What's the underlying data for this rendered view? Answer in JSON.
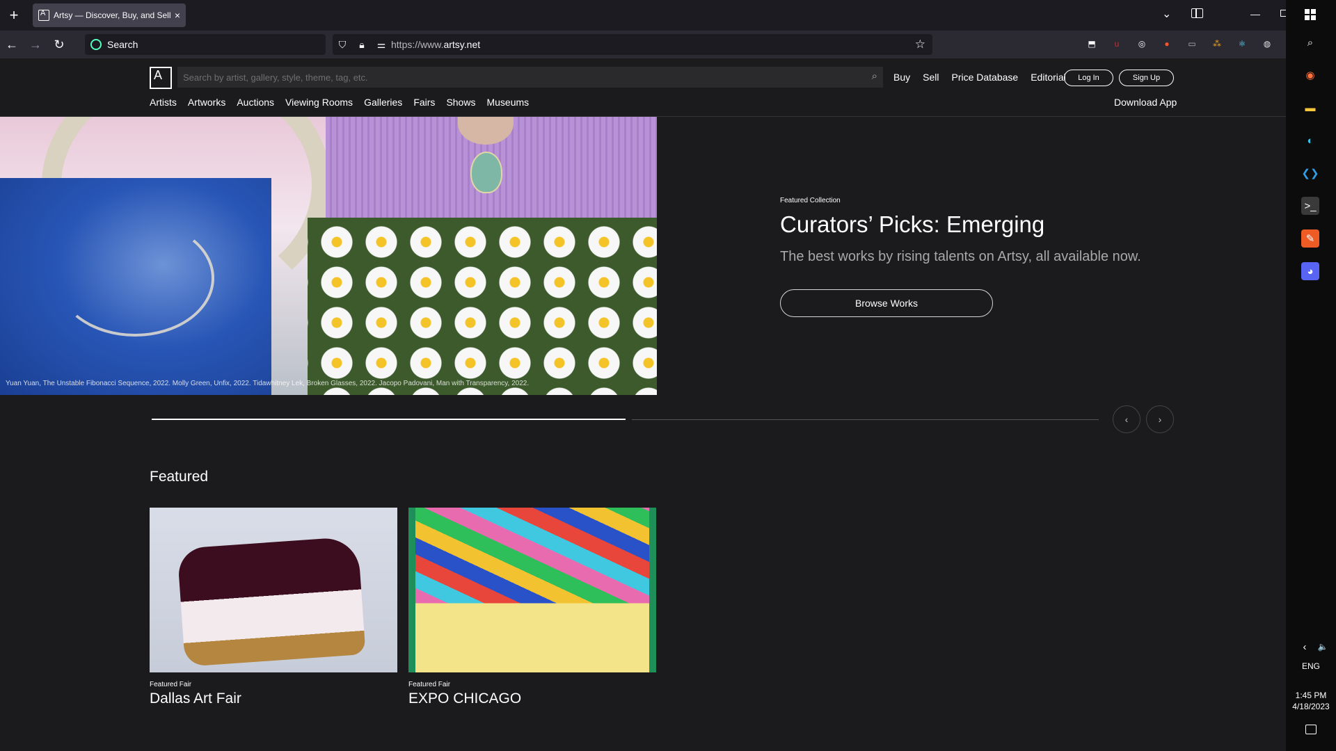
{
  "browser": {
    "tab_title": "Artsy — Discover, Buy, and Sell Fine Art",
    "search_placeholder": "Search",
    "url_scheme": "https://www.",
    "url_domain": "artsy.net",
    "new_tab_icon": "+",
    "tab_close_icon": "×",
    "back_icon": "←",
    "forward_icon": "→",
    "reload_icon": "↻",
    "bookmark_icon": "☆",
    "tab_list_icon": "⌄",
    "minimize_icon": "—",
    "extensions": [
      {
        "name": "downloads-icon",
        "glyph": "⬒",
        "color": "#fbfbfe"
      },
      {
        "name": "ublock-icon",
        "glyph": "u",
        "color": "#c4302b"
      },
      {
        "name": "privacy-icon",
        "glyph": "◎",
        "color": "#fbfbfe"
      },
      {
        "name": "brave-icon",
        "glyph": "●",
        "color": "#fb542b"
      },
      {
        "name": "extension-icon",
        "glyph": "▭",
        "color": "#b0b0b0"
      },
      {
        "name": "dots-icon",
        "glyph": "⁂",
        "color": "#f4a51c"
      },
      {
        "name": "react-icon",
        "glyph": "⚛",
        "color": "#61dafb"
      },
      {
        "name": "globe-icon",
        "glyph": "◍",
        "color": "#e0e0e0"
      }
    ]
  },
  "site": {
    "logo": "A",
    "search_placeholder": "Search by artist, gallery, style, theme, tag, etc.",
    "top_links": [
      "Buy",
      "Sell",
      "Price Database",
      "Editorial"
    ],
    "login_label": "Log In",
    "signup_label": "Sign Up",
    "categories": [
      "Artists",
      "Artworks",
      "Auctions",
      "Viewing Rooms",
      "Galleries",
      "Fairs",
      "Shows",
      "Museums"
    ],
    "download_app": "Download App"
  },
  "hero": {
    "caption": "Yuan Yuan, The Unstable Fibonacci Sequence, 2022. Molly Green, Unfix, 2022. Tidawhitney Lek, Broken Glasses, 2022. Jacopo Padovani, Man with Transparency, 2022.",
    "kicker": "Featured Collection",
    "title": "Curators’ Picks: Emerging",
    "subtitle": "The best works by rising talents on Artsy, all available now.",
    "button": "Browse Works",
    "carousel_progress": 0.5
  },
  "featured": {
    "heading": "Featured",
    "cards": [
      {
        "kicker": "Featured Fair",
        "title": "Dallas Art Fair"
      },
      {
        "kicker": "Featured Fair",
        "title": "EXPO CHICAGO"
      }
    ]
  },
  "taskbar": {
    "apps": [
      {
        "name": "search-icon",
        "glyph": "⌕",
        "color": "#ffffff",
        "bg": "transparent"
      },
      {
        "name": "firefox-icon",
        "glyph": "◉",
        "color": "#ff7139",
        "bg": "transparent"
      },
      {
        "name": "file-explorer-icon",
        "glyph": "▬",
        "color": "#f8c63a",
        "bg": "transparent"
      },
      {
        "name": "edge-icon",
        "glyph": "◐",
        "color": "#33c3e8",
        "bg": "transparent"
      },
      {
        "name": "vscode-icon",
        "glyph": "❮❯",
        "color": "#2f9ee6",
        "bg": "transparent"
      },
      {
        "name": "terminal-icon",
        "glyph": ">_",
        "color": "#ffffff",
        "bg": "#3a3a3a"
      },
      {
        "name": "postman-icon",
        "glyph": "✎",
        "color": "#ffffff",
        "bg": "#ef5b25"
      },
      {
        "name": "discord-icon",
        "glyph": "◕",
        "color": "#ffffff",
        "bg": "#5865f2"
      }
    ],
    "chevron_icon": "‹",
    "volume_icon": "🔈",
    "language": "ENG",
    "time": "1:45 PM",
    "date": "4/18/2023"
  }
}
